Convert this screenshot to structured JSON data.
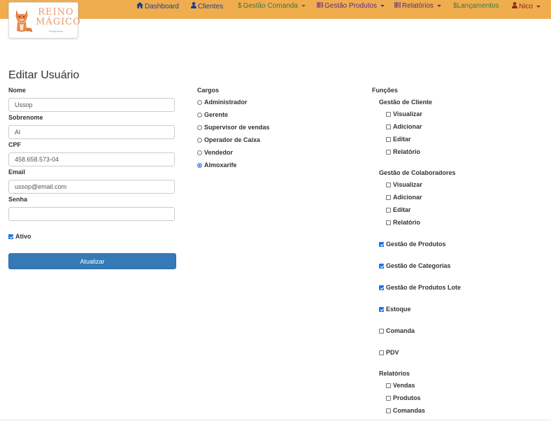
{
  "logo": {
    "line1": "REINO",
    "line2": "MÁGICO",
    "tagline": "Brinquedos"
  },
  "navbar": {
    "dashboard": "Dashboard",
    "clientes": "Clientes",
    "gestao_comanda": "Gestão Comanda",
    "gestao_produtos": "Gestão Produtos",
    "relatorios": "Relatórios",
    "lancamentos": "Lançamentos",
    "user": "Nico"
  },
  "form": {
    "title": "Editar Usuário",
    "nome_label": "Nome",
    "nome_value": "Ussop",
    "sobrenome_label": "Sobrenome",
    "sobrenome_value": "Al",
    "cpf_label": "CPF",
    "cpf_value": "458.658.573-04",
    "email_label": "Email",
    "email_value": "ussop@email.com",
    "senha_label": "Senha",
    "senha_value": "",
    "ativo_label": "Ativo",
    "ativo_checked": true,
    "submit_label": "Atualizar"
  },
  "cargos": {
    "label": "Cargos",
    "options": [
      {
        "label": "Administrador",
        "selected": false
      },
      {
        "label": "Gerente",
        "selected": false
      },
      {
        "label": "Supervisor de vendas",
        "selected": false
      },
      {
        "label": "Operador de Caixa",
        "selected": false
      },
      {
        "label": "Vendedor",
        "selected": false
      },
      {
        "label": "Almoxarife",
        "selected": true
      }
    ]
  },
  "funcoes": {
    "label": "Funções",
    "gestao_cliente": {
      "label": "Gestão de Cliente",
      "items": [
        {
          "label": "Visualizar",
          "checked": false
        },
        {
          "label": "Adicionar",
          "checked": false
        },
        {
          "label": "Editar",
          "checked": false
        },
        {
          "label": "Relatório",
          "checked": false
        }
      ]
    },
    "gestao_colaboradores": {
      "label": "Gestão de Colaboradores",
      "items": [
        {
          "label": "Visualizar",
          "checked": false
        },
        {
          "label": "Adicionar",
          "checked": false
        },
        {
          "label": "Editar",
          "checked": false
        },
        {
          "label": "Relatório",
          "checked": false
        }
      ]
    },
    "singles": [
      {
        "label": "Gestão de Produtos",
        "checked": true
      },
      {
        "label": "Gestão de Categorias",
        "checked": true
      },
      {
        "label": "Gestão de Produtos Lote",
        "checked": true
      },
      {
        "label": "Estoque",
        "checked": true
      },
      {
        "label": "Comanda",
        "checked": false
      },
      {
        "label": "PDV",
        "checked": false
      }
    ],
    "relatorios": {
      "label": "Relatórios",
      "items": [
        {
          "label": "Vendas",
          "checked": false
        },
        {
          "label": "Produtos",
          "checked": false
        },
        {
          "label": "Comandas",
          "checked": false
        }
      ]
    }
  },
  "colors": {
    "navbar_bg": "#f0ad4e",
    "primary": "#337ab7",
    "check_accent": "#1a73e8"
  }
}
